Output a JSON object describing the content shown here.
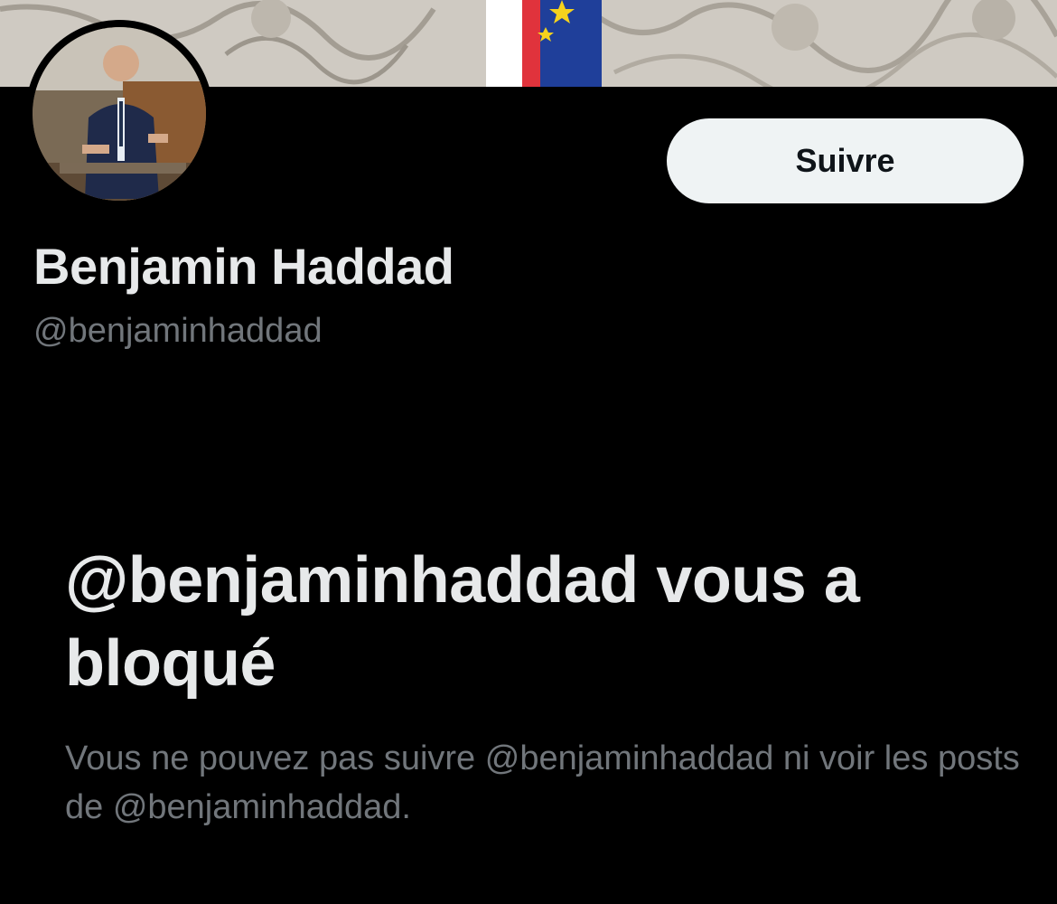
{
  "profile": {
    "display_name": "Benjamin Haddad",
    "handle": "@benjaminhaddad",
    "follow_label": "Suivre"
  },
  "blocked": {
    "title": "@benjaminhaddad vous a bloqué",
    "description": "Vous ne pouvez pas suivre @benjaminhaddad ni voir les posts de @benjaminhaddad."
  },
  "icons": {
    "banner": "banner-image",
    "avatar": "avatar-image"
  },
  "colors": {
    "background": "#000000",
    "primary_text": "#e7e9ea",
    "secondary_text": "#71767b",
    "button_bg": "#eff3f4",
    "button_text": "#0f1419"
  }
}
